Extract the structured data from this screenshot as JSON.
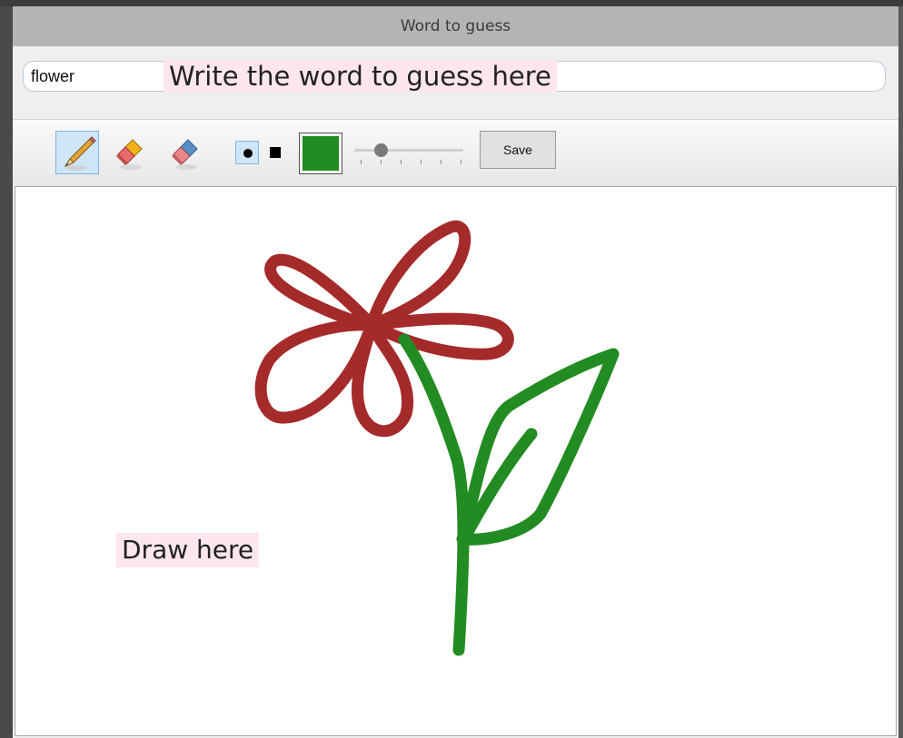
{
  "window": {
    "title": "Word to guess"
  },
  "word_input": {
    "value": "flower",
    "hint": "Write the word to guess here"
  },
  "toolbar": {
    "tools": [
      {
        "name": "pencil-icon",
        "active": true
      },
      {
        "name": "highlighter-eraser-icon",
        "active": false
      },
      {
        "name": "eraser-icon",
        "active": false
      }
    ],
    "brush_shape": {
      "options": [
        "round",
        "square"
      ],
      "selected": "round"
    },
    "selected_color": "#228B22",
    "brush_size_fraction": 0.22,
    "save_label": "Save"
  },
  "canvas": {
    "hint": "Draw here",
    "stroke_colors": {
      "petals": "#A52A2A",
      "stem": "#228B22"
    }
  }
}
